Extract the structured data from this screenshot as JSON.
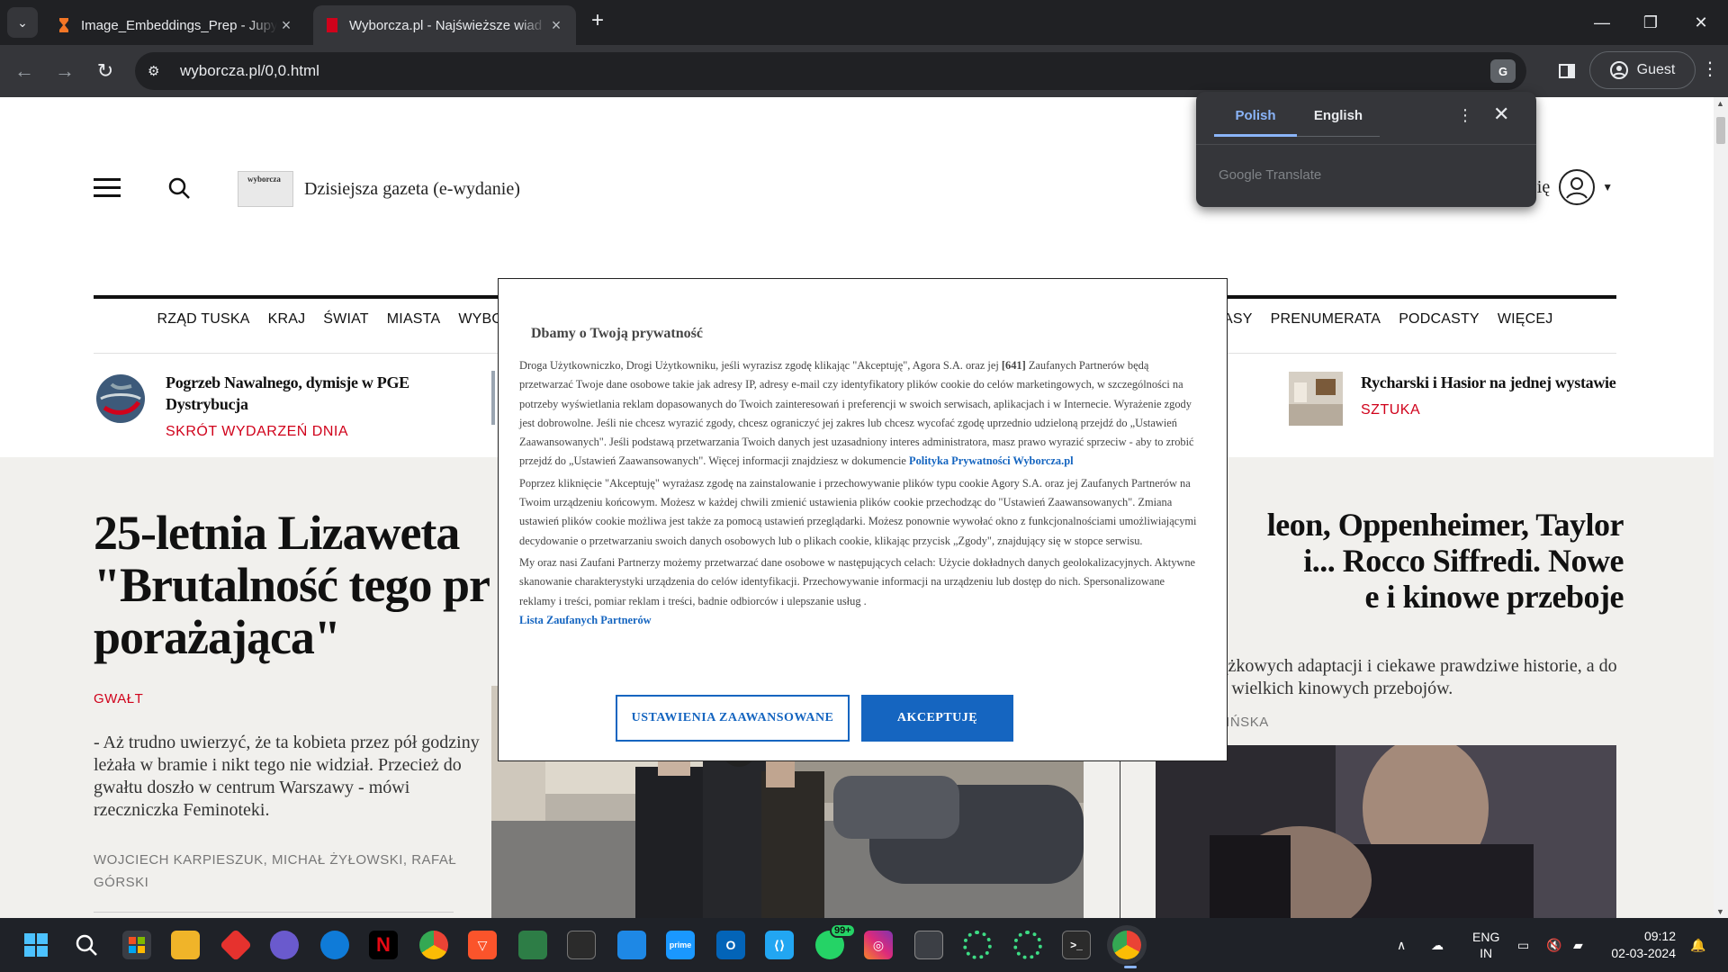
{
  "browser": {
    "tabs": [
      {
        "title": "Image_Embeddings_Prep - Jupy",
        "active": false
      },
      {
        "title": "Wyborcza.pl - Najświeższe wiad",
        "active": true
      }
    ],
    "url": "wyborcza.pl/0,0.html",
    "guest_label": "Guest",
    "translate_chip": "G"
  },
  "page": {
    "egazeta_cover": "wyborcza",
    "egazeta_label": "Dzisiejsza gazeta (e-wydanie)",
    "login_label": "się",
    "nav": [
      "RZĄD TUSKA",
      "KRAJ",
      "ŚWIAT",
      "MIASTA",
      "WYBO",
      "ASY",
      "PRENUMERATA",
      "PODCASTY",
      "WIĘCEJ"
    ],
    "teasers": [
      {
        "title": "Pogrzeb Nawalnego, dymisje w PGE Dystrybucja",
        "category": "SKRÓT WYDARZEŃ DNIA"
      },
      {
        "title": "Rycharski i Hasior na jednej wystawie",
        "category": "SZTUKA"
      }
    ],
    "lead": {
      "headline_lines": [
        "25-letnia Lizaweta",
        "\"Brutalność tego pr",
        "porażająca\""
      ],
      "category": "GWAŁT",
      "lede": "- Aż trudno uwierzyć, że ta kobieta przez pół godziny leżała w bramie i nikt tego nie widział. Przecież do gwałtu doszło w centrum Warszawy - mówi rzeczniczka Feminoteki.",
      "authors": "WOJCIECH KARPIESZUK, MICHAŁ ŻYŁOWSKI, RAFAŁ GÓRSKI"
    },
    "right": {
      "headline_lines": [
        "leon, Oppenheimer, Taylor",
        "i... Rocco Siffredi. Nowe",
        "e i kinowe przeboje"
      ],
      "lede": "Dużo książkowych adaptacji i ciekawe prawdziwe historie, a do tego kilka wielkich kinowych przebojów.",
      "author": "ANNA ŻABIŃSKA"
    }
  },
  "consent": {
    "title": "Dbamy o Twoją prywatność",
    "p1a": "Droga Użytkowniczko, Drogi Użytkowniku, jeśli wyrazisz zgodę klikając \"Akceptuję\", Agora S.A. oraz jej ",
    "p1_count": "[641]",
    "p1b": " Zaufanych Partnerów będą przetwarzać Twoje dane osobowe takie jak adresy IP, adresy e-mail czy identyfikatory plików cookie do celów marketingowych, w szczególności na potrzeby wyświetlania reklam dopasowanych do Twoich zainteresowań i preferencji w swoich serwisach, aplikacjach i w Internecie. Wyrażenie zgody jest dobrowolne. Jeśli nie chcesz wyrazić zgody, chcesz ograniczyć jej zakres lub chcesz wycofać zgodę uprzednio udzieloną przejdź do „Ustawień Zaawansowanych\". Jeśli podstawą przetwarzania Twoich danych jest uzasadniony interes administratora, masz prawo wyrazić sprzeciw - aby to zrobić przejdź do „Ustawień Zaawansowanych\". Więcej informacji znajdziesz w dokumencie ",
    "p1_link": "Polityka Prywatności Wyborcza.pl",
    "p2": "Poprzez kliknięcie \"Akceptuję\" wyrażasz zgodę na zainstalowanie i przechowywanie plików typu cookie Agory S.A. oraz jej Zaufanych Partnerów na Twoim urządzeniu końcowym. Możesz w każdej chwili zmienić ustawienia plików cookie przechodząc do \"Ustawień Zaawansowanych\". Zmiana ustawień plików cookie możliwa jest także za pomocą ustawień przeglądarki. Możesz ponownie wywołać okno z funkcjonalnościami umożliwiającymi decydowanie o przetwarzaniu swoich danych osobowych lub o plikach cookie, klikając przycisk „Zgody\", znajdujący się w stopce serwisu.",
    "p3": "My oraz nasi Zaufani Partnerzy możemy przetwarzać dane osobowe w następujących celach: Użycie dokładnych danych geolokalizacyjnych. Aktywne skanowanie charakterystyki urządzenia do celów identyfikacji. Przechowywanie informacji na urządzeniu lub dostęp do nich. Spersonalizowane reklamy i treści, pomiar reklam i treści, badnie odbiorców i ulepszanie usług .",
    "p3_link": "Lista Zaufanych Partnerów",
    "btn_advanced": "USTAWIENIA ZAAWANSOWANE",
    "btn_accept": "AKCEPTUJĘ"
  },
  "translate": {
    "lang_source": "Polish",
    "lang_target": "English",
    "brand": "Google Translate"
  },
  "taskbar": {
    "whatsapp_badge": "99+",
    "lang_top": "ENG",
    "lang_bottom": "IN",
    "time": "09:12",
    "date": "02-03-2024"
  }
}
